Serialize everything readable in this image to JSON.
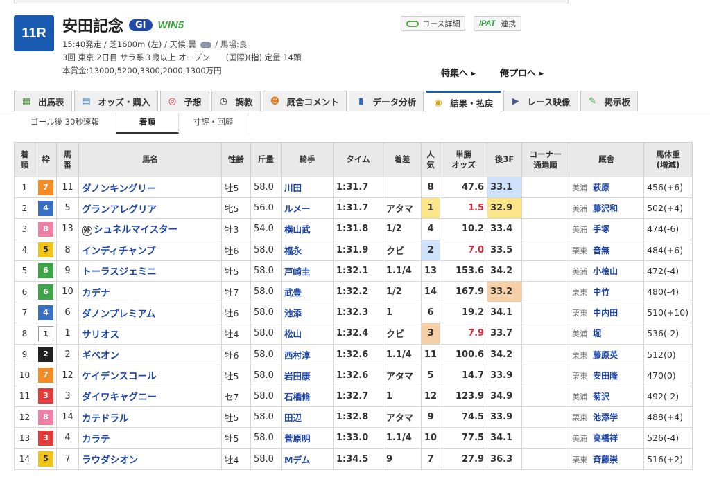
{
  "race": {
    "number": "11R",
    "name": "安田記念",
    "grade": "GI",
    "win5": "WIN5",
    "line1_pre": "15:40発走 / 芝1600m (左) / 天候:曇",
    "line1_post": "/ 馬場:良",
    "line2": "3回 東京 2日目 サラ系３歳以上 オープン　　(国際)(指) 定量 14頭",
    "line3": "本賞金:13000,5200,3300,2000,1300万円"
  },
  "buttons": {
    "course_detail": "コース詳細",
    "ipat": "IPAT",
    "ipat_link": "連携"
  },
  "links": {
    "special": "特集へ ▸",
    "pro": "俺プロへ ▸"
  },
  "tabs": [
    {
      "label": "出馬表",
      "icon": "table-icon"
    },
    {
      "label": "オッズ・購入",
      "icon": "odds-icon"
    },
    {
      "label": "予想",
      "icon": "target-icon"
    },
    {
      "label": "調教",
      "icon": "stopwatch-icon"
    },
    {
      "label": "厩舎コメント",
      "icon": "comment-icon"
    },
    {
      "label": "データ分析",
      "icon": "bar-chart-icon"
    },
    {
      "label": "結果・払戻",
      "icon": "coins-icon"
    },
    {
      "label": "レース映像",
      "icon": "video-icon"
    },
    {
      "label": "掲示板",
      "icon": "board-icon"
    }
  ],
  "subtabs": [
    "ゴール後 30秒速報",
    "着順",
    "寸評・回顧"
  ],
  "headers": {
    "rank": "着順",
    "waku": "枠",
    "umaban": "馬番",
    "horse": "馬名",
    "sexage": "性齢",
    "kin": "斤量",
    "jockey": "騎手",
    "time": "タイム",
    "margin": "着差",
    "pop": "人気",
    "odds": "単勝オッズ",
    "last3f": "後3F",
    "corner": "コーナー通過順",
    "trainer": "厩舎",
    "weight": "馬体重(増減)"
  },
  "header_lines": {
    "rank": [
      "着",
      "順"
    ],
    "umaban": [
      "馬",
      "番"
    ],
    "pop": [
      "人",
      "気"
    ],
    "odds": [
      "単勝",
      "オッズ"
    ],
    "corner": [
      "コーナー",
      "通過順"
    ],
    "weight": [
      "馬体重",
      "(増減)"
    ]
  },
  "gaikoku_mark": "外",
  "rows": [
    {
      "rank": "1",
      "waku": "7",
      "umaban": "11",
      "horse": "ダノンキングリー",
      "gaiko": false,
      "sexage": "牡5",
      "kin": "58.0",
      "jockey": "川田",
      "time": "1:31.7",
      "margin": "",
      "pop": "8",
      "odds": "47.6",
      "hot": false,
      "last3f": "33.1",
      "l3": "p2",
      "loc": "美浦",
      "trainer": "萩原",
      "weight": "456(+6)"
    },
    {
      "rank": "2",
      "waku": "4",
      "umaban": "5",
      "horse": "グランアレグリア",
      "gaiko": false,
      "sexage": "牝5",
      "kin": "56.0",
      "jockey": "ルメー",
      "time": "1:31.7",
      "margin": "アタマ",
      "pop": "1",
      "popc": "p1",
      "odds": "1.5",
      "hot": true,
      "last3f": "32.9",
      "l3": "p1",
      "loc": "美浦",
      "trainer": "藤沢和",
      "weight": "502(+4)"
    },
    {
      "rank": "3",
      "waku": "8",
      "umaban": "13",
      "horse": "シュネルマイスター",
      "gaiko": true,
      "sexage": "牡3",
      "kin": "54.0",
      "jockey": "横山武",
      "time": "1:31.8",
      "margin": "1/2",
      "pop": "4",
      "odds": "10.2",
      "hot": false,
      "last3f": "33.4",
      "l3": "",
      "loc": "美浦",
      "trainer": "手塚",
      "weight": "474(-6)"
    },
    {
      "rank": "4",
      "waku": "5",
      "umaban": "8",
      "horse": "インディチャンプ",
      "gaiko": false,
      "sexage": "牡6",
      "kin": "58.0",
      "jockey": "福永",
      "time": "1:31.9",
      "margin": "クビ",
      "pop": "2",
      "popc": "p2",
      "odds": "7.0",
      "hot": true,
      "last3f": "33.5",
      "l3": "",
      "loc": "栗東",
      "trainer": "音無",
      "weight": "484(+6)"
    },
    {
      "rank": "5",
      "waku": "6",
      "umaban": "9",
      "horse": "トーラスジェミニ",
      "gaiko": false,
      "sexage": "牡5",
      "kin": "58.0",
      "jockey": "戸崎圭",
      "time": "1:32.1",
      "margin": "1.1/4",
      "pop": "13",
      "odds": "153.6",
      "hot": false,
      "last3f": "34.2",
      "l3": "",
      "loc": "美浦",
      "trainer": "小桧山",
      "weight": "472(-4)"
    },
    {
      "rank": "6",
      "waku": "6",
      "umaban": "10",
      "horse": "カデナ",
      "gaiko": false,
      "sexage": "牡7",
      "kin": "58.0",
      "jockey": "武豊",
      "time": "1:32.2",
      "margin": "1/2",
      "pop": "14",
      "odds": "167.9",
      "hot": false,
      "last3f": "33.2",
      "l3": "p3",
      "loc": "栗東",
      "trainer": "中竹",
      "weight": "480(-4)"
    },
    {
      "rank": "7",
      "waku": "4",
      "umaban": "6",
      "horse": "ダノンプレミアム",
      "gaiko": false,
      "sexage": "牡6",
      "kin": "58.0",
      "jockey": "池添",
      "time": "1:32.3",
      "margin": "1",
      "pop": "6",
      "odds": "19.2",
      "hot": false,
      "last3f": "34.1",
      "l3": "",
      "loc": "栗東",
      "trainer": "中内田",
      "weight": "510(+10)"
    },
    {
      "rank": "8",
      "waku": "1",
      "umaban": "1",
      "horse": "サリオス",
      "gaiko": false,
      "sexage": "牡4",
      "kin": "58.0",
      "jockey": "松山",
      "time": "1:32.4",
      "margin": "クビ",
      "pop": "3",
      "popc": "p3",
      "odds": "7.9",
      "hot": true,
      "last3f": "33.7",
      "l3": "",
      "loc": "美浦",
      "trainer": "堀",
      "weight": "536(-2)"
    },
    {
      "rank": "9",
      "waku": "2",
      "umaban": "2",
      "horse": "ギベオン",
      "gaiko": false,
      "sexage": "牡6",
      "kin": "58.0",
      "jockey": "西村淳",
      "time": "1:32.6",
      "margin": "1.1/4",
      "pop": "11",
      "odds": "100.6",
      "hot": false,
      "last3f": "34.2",
      "l3": "",
      "loc": "栗東",
      "trainer": "藤原英",
      "weight": "512(0)"
    },
    {
      "rank": "10",
      "waku": "7",
      "umaban": "12",
      "horse": "ケイデンスコール",
      "gaiko": false,
      "sexage": "牡5",
      "kin": "58.0",
      "jockey": "岩田康",
      "time": "1:32.6",
      "margin": "アタマ",
      "pop": "5",
      "odds": "14.7",
      "hot": false,
      "last3f": "33.9",
      "l3": "",
      "loc": "栗東",
      "trainer": "安田隆",
      "weight": "470(0)"
    },
    {
      "rank": "11",
      "waku": "3",
      "umaban": "3",
      "horse": "ダイワキャグニー",
      "gaiko": false,
      "sexage": "セ7",
      "kin": "58.0",
      "jockey": "石橋脩",
      "time": "1:32.7",
      "margin": "1",
      "pop": "12",
      "odds": "123.9",
      "hot": false,
      "last3f": "34.9",
      "l3": "",
      "loc": "美浦",
      "trainer": "菊沢",
      "weight": "492(-2)"
    },
    {
      "rank": "12",
      "waku": "8",
      "umaban": "14",
      "horse": "カテドラル",
      "gaiko": false,
      "sexage": "牡5",
      "kin": "58.0",
      "jockey": "田辺",
      "time": "1:32.8",
      "margin": "アタマ",
      "pop": "9",
      "odds": "74.5",
      "hot": false,
      "last3f": "33.9",
      "l3": "",
      "loc": "栗東",
      "trainer": "池添学",
      "weight": "488(+4)"
    },
    {
      "rank": "13",
      "waku": "3",
      "umaban": "4",
      "horse": "カラテ",
      "gaiko": false,
      "sexage": "牡5",
      "kin": "58.0",
      "jockey": "菅原明",
      "time": "1:33.0",
      "margin": "1.1/4",
      "pop": "10",
      "odds": "77.5",
      "hot": false,
      "last3f": "34.1",
      "l3": "",
      "loc": "美浦",
      "trainer": "高橋祥",
      "weight": "526(-4)"
    },
    {
      "rank": "14",
      "waku": "5",
      "umaban": "7",
      "horse": "ラウダシオン",
      "gaiko": false,
      "sexage": "牡4",
      "kin": "58.0",
      "jockey": "Mデム",
      "time": "1:34.5",
      "margin": "9",
      "pop": "7",
      "odds": "27.9",
      "hot": false,
      "last3f": "36.3",
      "l3": "",
      "loc": "栗東",
      "trainer": "斉藤崇",
      "weight": "516(+2)"
    }
  ]
}
